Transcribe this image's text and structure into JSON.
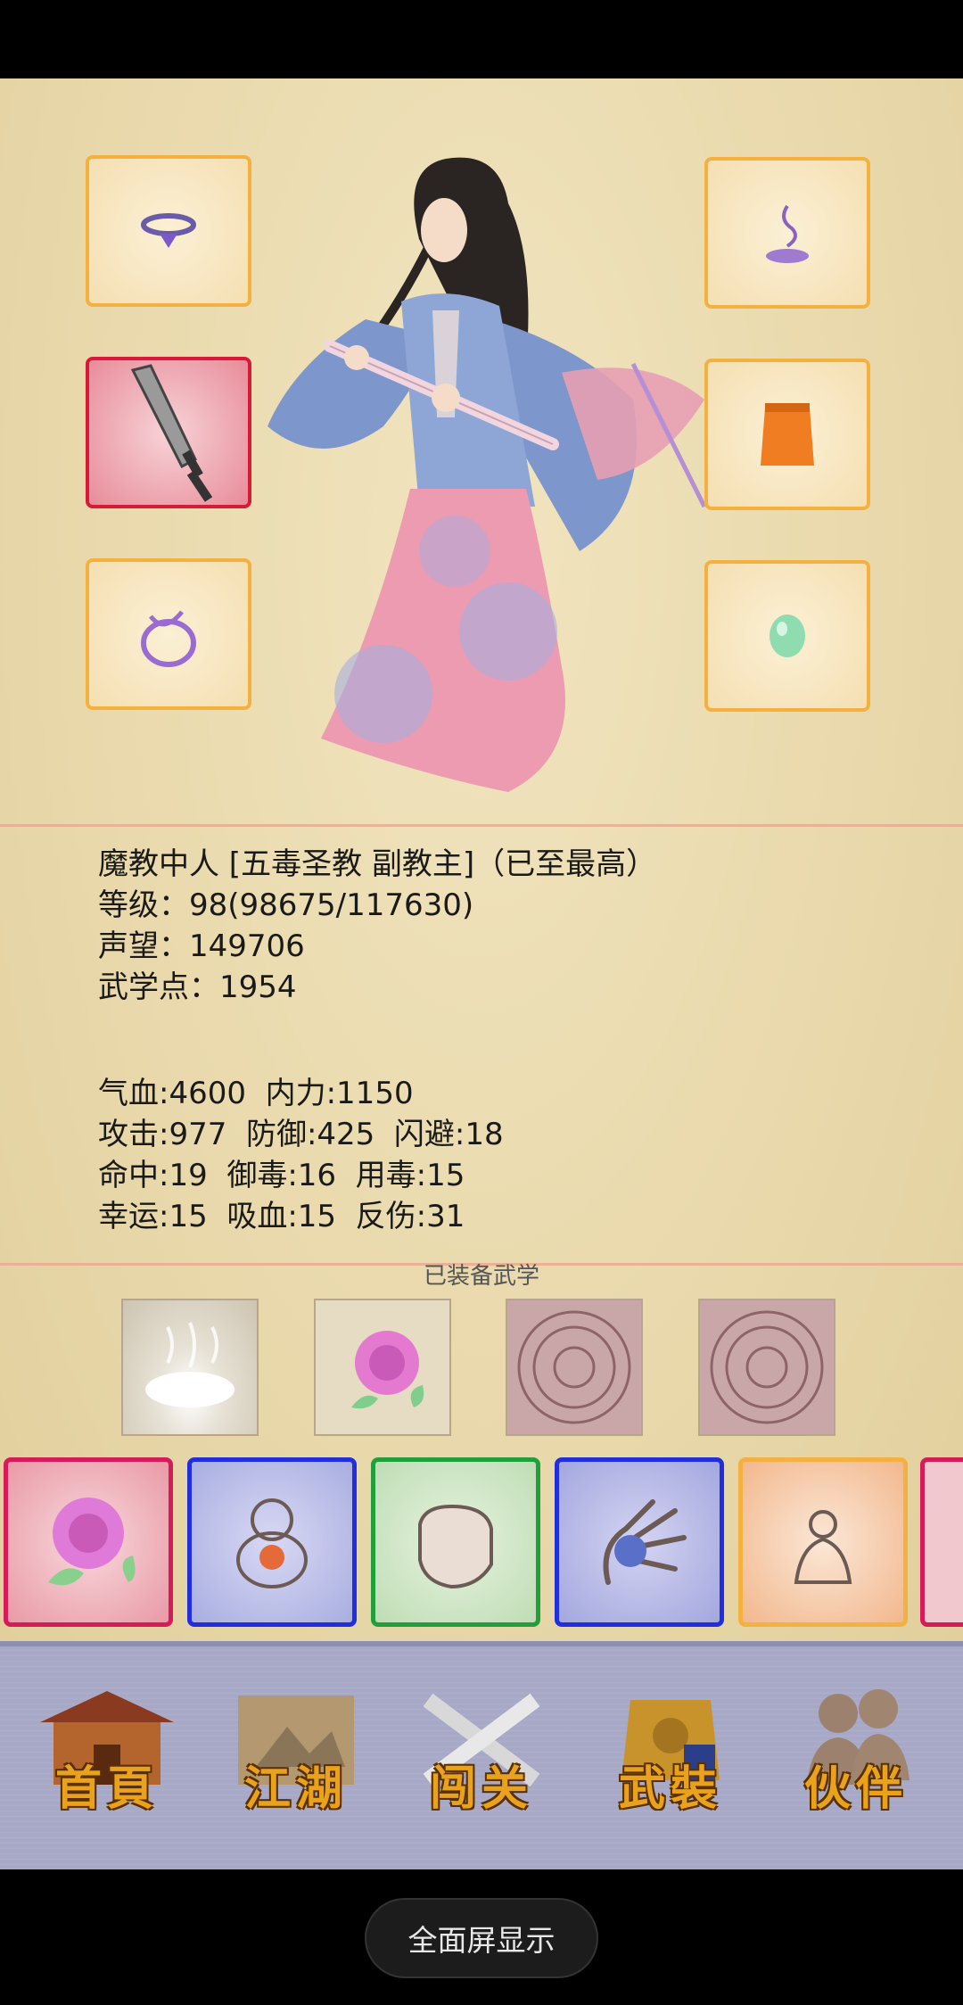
{
  "character": {
    "title_line": "魔教中人 [五毒圣教 副教主]（已至最高）",
    "level_line": "等级：98(98675/117630)",
    "prestige_line": "声望：149706",
    "martial_points_line": "武学点：1954"
  },
  "stats": {
    "row1": "气血:4600  内力:1150",
    "row2": "攻击:977  防御:425  闪避:18",
    "row3": "命中:19  御毒:16  用毒:15",
    "row4": "幸运:15  吸血:15  反伤:31"
  },
  "equipped_martial_label": "已装备武学",
  "nav": {
    "home": "首頁",
    "jianghu": "江湖",
    "chuangguan": "闯关",
    "wuzhuang": "武裝",
    "partner": "伙伴"
  },
  "fullscreen_button": "全面屏显示",
  "colors": {
    "slot_border": "#f5b140",
    "selected_slot_border": "#d61a3a",
    "nav_text": "#e8a21e"
  }
}
